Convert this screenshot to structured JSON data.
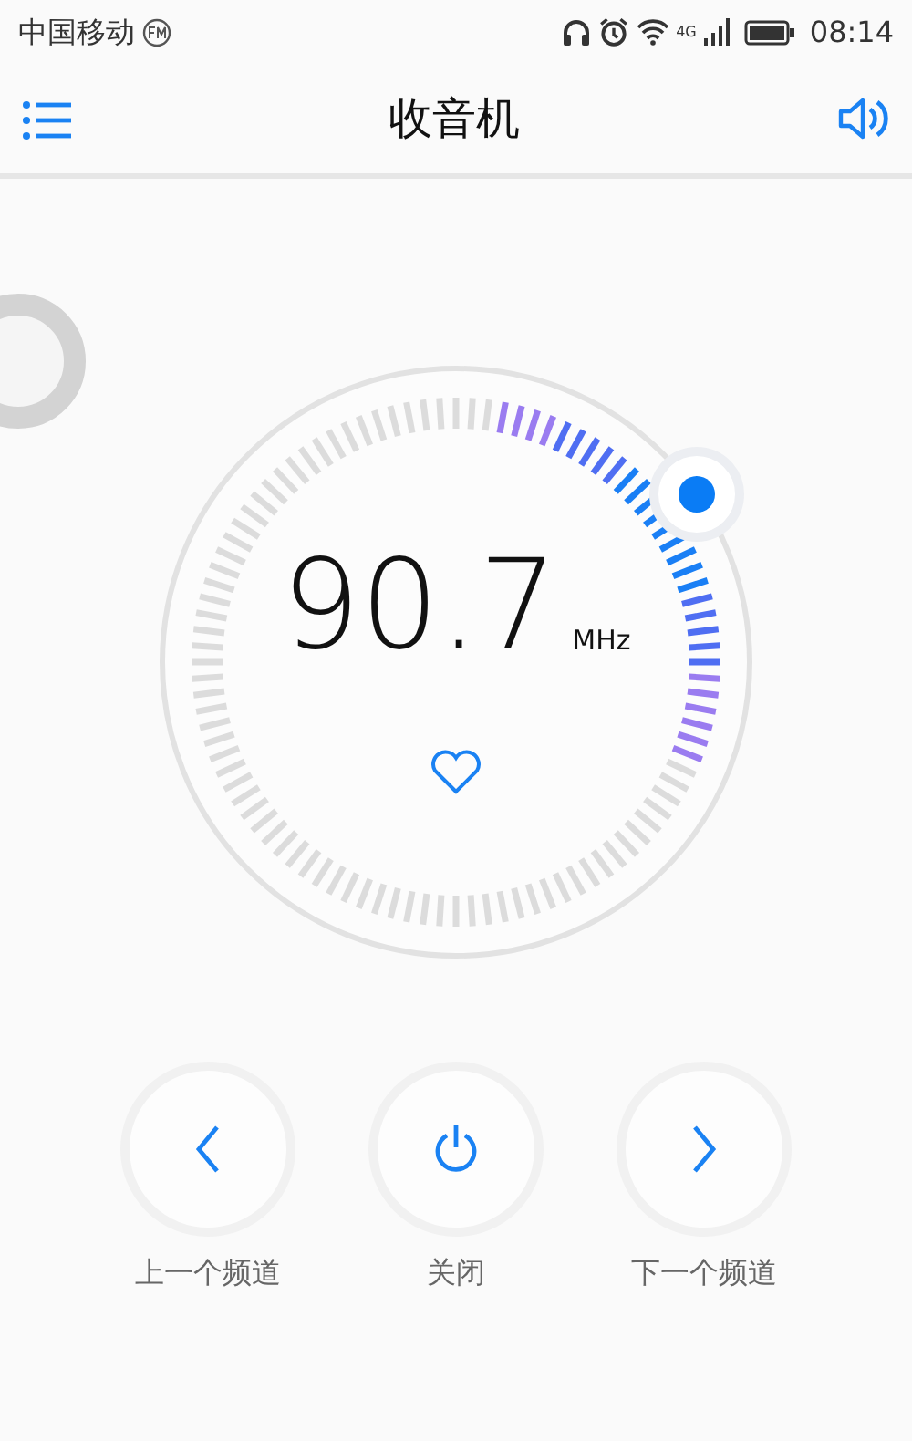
{
  "status_bar": {
    "carrier": "中国移动",
    "network": "4G",
    "time": "08:14"
  },
  "header": {
    "title": "收音机"
  },
  "tuner": {
    "frequency": "90.7",
    "unit": "MHz",
    "favorite": false
  },
  "controls": [
    {
      "kind": "prev",
      "label": "上一个频道"
    },
    {
      "kind": "power",
      "label": "关闭"
    },
    {
      "kind": "next",
      "label": "下一个频道"
    }
  ]
}
